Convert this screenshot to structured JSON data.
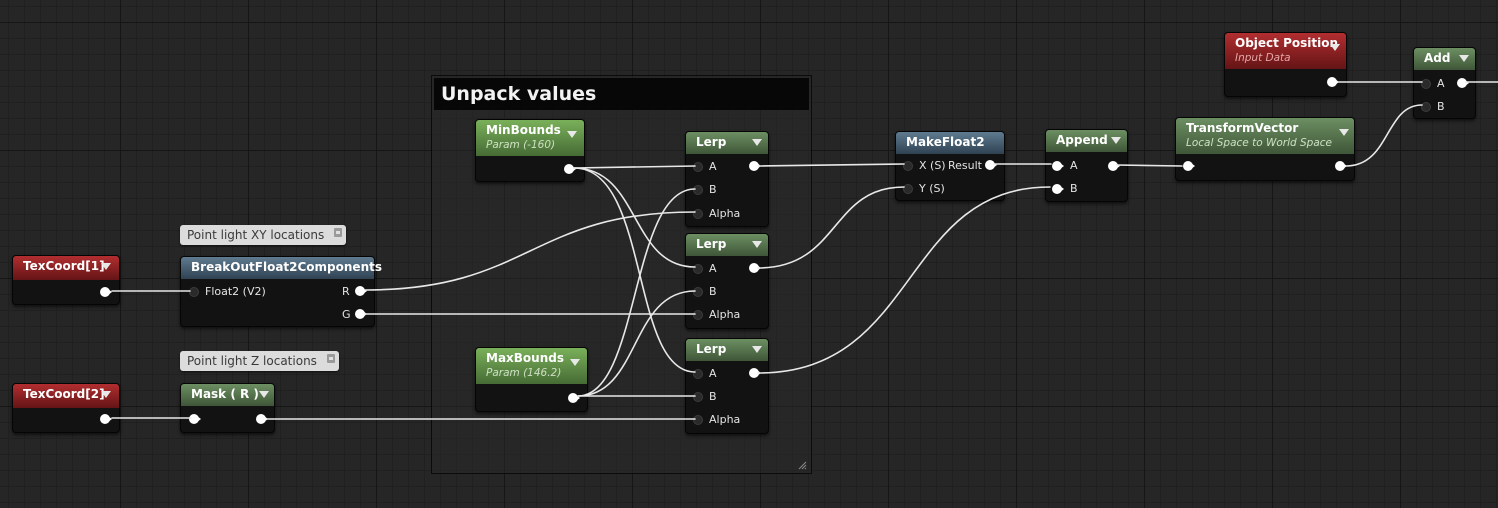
{
  "comment": {
    "title": "Unpack values"
  },
  "bubbles": {
    "xy": "Point light XY locations",
    "z": "Point light Z locations"
  },
  "nodes": {
    "texcoord1": {
      "title": "TexCoord[1]"
    },
    "texcoord2": {
      "title": "TexCoord[2]"
    },
    "breakout": {
      "title": "BreakOutFloat2Components",
      "in": "Float2 (V2)",
      "out_r": "R",
      "out_g": "G"
    },
    "mask": {
      "title": "Mask ( R )"
    },
    "minbounds": {
      "title": "MinBounds",
      "sub": "Param (-160)"
    },
    "maxbounds": {
      "title": "MaxBounds",
      "sub": "Param (146.2)"
    },
    "lerp1": {
      "title": "Lerp",
      "a": "A",
      "b": "B",
      "alpha": "Alpha"
    },
    "lerp2": {
      "title": "Lerp",
      "a": "A",
      "b": "B",
      "alpha": "Alpha"
    },
    "lerp3": {
      "title": "Lerp",
      "a": "A",
      "b": "B",
      "alpha": "Alpha"
    },
    "makefloat2": {
      "title": "MakeFloat2",
      "x": "X (S)",
      "y": "Y (S)",
      "result": "Result"
    },
    "append": {
      "title": "Append",
      "a": "A",
      "b": "B"
    },
    "transform": {
      "title": "TransformVector",
      "sub": "Local Space to World Space"
    },
    "objpos": {
      "title": "Object Position",
      "sub": "Input Data"
    },
    "add": {
      "title": "Add",
      "a": "A",
      "b": "B"
    }
  }
}
